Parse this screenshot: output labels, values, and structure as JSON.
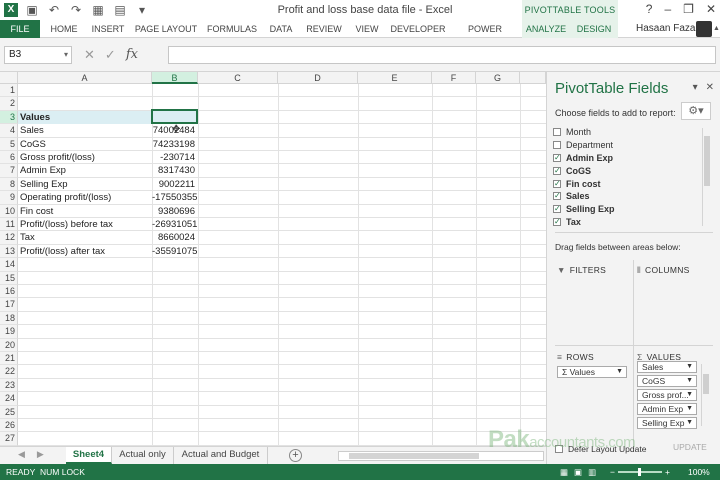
{
  "window": {
    "title": "Profit and loss base data file - Excel",
    "app_icon": "X",
    "context_tools_label": "PIVOTTABLE TOOLS",
    "controls": {
      "help": "?",
      "minimize": "–",
      "restore": "❐",
      "close": "✕"
    }
  },
  "ribbon": {
    "tabs": [
      {
        "label": "FILE"
      },
      {
        "label": "HOME"
      },
      {
        "label": "INSERT"
      },
      {
        "label": "PAGE LAYOUT"
      },
      {
        "label": "FORMULAS"
      },
      {
        "label": "DATA"
      },
      {
        "label": "REVIEW"
      },
      {
        "label": "VIEW"
      },
      {
        "label": "DEVELOPER"
      },
      {
        "label": "POWER QUERY"
      },
      {
        "label": "ANALYZE"
      },
      {
        "label": "DESIGN"
      }
    ],
    "user": "Hasaan Fazal"
  },
  "formula_bar": {
    "name_box": "B3",
    "fx": "fx",
    "formula": ""
  },
  "grid": {
    "columns": [
      "A",
      "B",
      "C",
      "D",
      "E",
      "F",
      "G"
    ],
    "selected_column": "B",
    "selected_row": 3,
    "rows": [
      {
        "n": "1",
        "a": "",
        "b": ""
      },
      {
        "n": "2",
        "a": "",
        "b": ""
      },
      {
        "n": "3",
        "a": "Values",
        "b": ""
      },
      {
        "n": "4",
        "a": "Sales",
        "b": "74002484"
      },
      {
        "n": "5",
        "a": "CoGS",
        "b": "74233198"
      },
      {
        "n": "6",
        "a": "Gross profit/(loss)",
        "b": "-230714"
      },
      {
        "n": "7",
        "a": "Admin Exp",
        "b": "8317430"
      },
      {
        "n": "8",
        "a": "Selling Exp",
        "b": "9002211"
      },
      {
        "n": "9",
        "a": "Operating profit/(loss)",
        "b": "-17550355"
      },
      {
        "n": "10",
        "a": "Fin cost",
        "b": "9380696"
      },
      {
        "n": "11",
        "a": "Profit/(loss) before tax",
        "b": "-26931051"
      },
      {
        "n": "12",
        "a": "Tax",
        "b": "8660024"
      },
      {
        "n": "13",
        "a": "Profit/(loss) after tax",
        "b": "-35591075"
      },
      {
        "n": "14",
        "a": "",
        "b": ""
      },
      {
        "n": "15",
        "a": "",
        "b": ""
      },
      {
        "n": "16",
        "a": "",
        "b": ""
      },
      {
        "n": "17",
        "a": "",
        "b": ""
      },
      {
        "n": "18",
        "a": "",
        "b": ""
      },
      {
        "n": "19",
        "a": "",
        "b": ""
      },
      {
        "n": "20",
        "a": "",
        "b": ""
      },
      {
        "n": "21",
        "a": "",
        "b": ""
      },
      {
        "n": "22",
        "a": "",
        "b": ""
      },
      {
        "n": "23",
        "a": "",
        "b": ""
      },
      {
        "n": "24",
        "a": "",
        "b": ""
      },
      {
        "n": "25",
        "a": "",
        "b": ""
      },
      {
        "n": "26",
        "a": "",
        "b": ""
      },
      {
        "n": "27",
        "a": "",
        "b": ""
      }
    ]
  },
  "sheets": {
    "tabs": [
      {
        "label": "Sheet4",
        "active": true
      },
      {
        "label": "Actual only",
        "active": false
      },
      {
        "label": "Actual and Budget",
        "active": false
      }
    ],
    "add_label": "+"
  },
  "pivot_pane": {
    "title": "PivotTable Fields",
    "subtitle": "Choose fields to add to report:",
    "fields": [
      {
        "label": "Month",
        "checked": false
      },
      {
        "label": "Department",
        "checked": false
      },
      {
        "label": "Admin Exp",
        "checked": true
      },
      {
        "label": "CoGS",
        "checked": true
      },
      {
        "label": "Fin cost",
        "checked": true
      },
      {
        "label": "Sales",
        "checked": true
      },
      {
        "label": "Selling Exp",
        "checked": true
      },
      {
        "label": "Tax",
        "checked": true
      }
    ],
    "drag_label": "Drag fields between areas below:",
    "areas": {
      "filters": "FILTERS",
      "columns": "COLUMNS",
      "rows": "ROWS",
      "values": "VALUES"
    },
    "rows_items": [
      "Σ  Values"
    ],
    "values_items": [
      "Sales",
      "CoGS",
      "Gross prof...",
      "Admin Exp",
      "Selling Exp"
    ],
    "defer_label": "Defer Layout Update",
    "update_label": "UPDATE"
  },
  "watermark": {
    "main": "Pak",
    "rest": "accountants.com"
  },
  "status": {
    "ready": "READY",
    "numlock": "NUM LOCK",
    "zoom": "100%",
    "zoom_minus": "−",
    "zoom_plus": "+"
  },
  "colors": {
    "accent": "#217346",
    "header_fill": "#dbeef3"
  }
}
